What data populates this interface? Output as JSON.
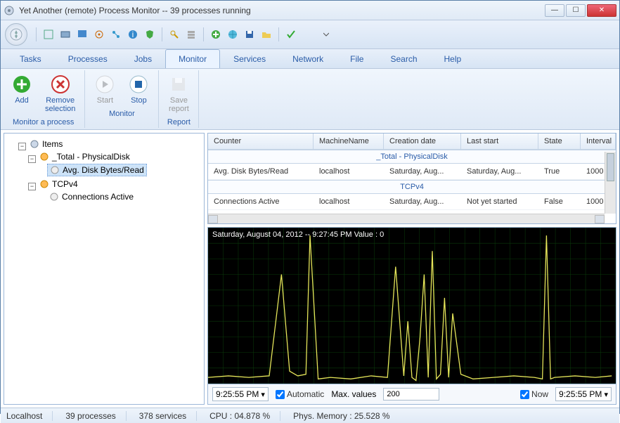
{
  "window": {
    "title": "Yet Another (remote) Process Monitor -- 39 processes running"
  },
  "menu": [
    "Tasks",
    "Processes",
    "Jobs",
    "Monitor",
    "Services",
    "Network",
    "File",
    "Search",
    "Help"
  ],
  "menu_active": 3,
  "ribbon": {
    "groups": [
      {
        "caption": "Monitor a process",
        "buttons": [
          {
            "label": "Add",
            "icon": "plus",
            "color": "#3a3"
          },
          {
            "label": "Remove\nselection",
            "icon": "x",
            "color": "#c33"
          }
        ]
      },
      {
        "caption": "Monitor",
        "buttons": [
          {
            "label": "Start",
            "icon": "play",
            "color": "#888",
            "disabled": true
          },
          {
            "label": "Stop",
            "icon": "stop",
            "color": "#26a"
          }
        ]
      },
      {
        "caption": "Report",
        "buttons": [
          {
            "label": "Save\nreport",
            "icon": "save",
            "color": "#aaa",
            "disabled": true
          }
        ]
      }
    ]
  },
  "tree": {
    "root": "Items",
    "nodes": [
      {
        "label": "_Total - PhysicalDisk",
        "icon": "disk",
        "children": [
          {
            "label": "Avg. Disk Bytes/Read",
            "icon": "counter",
            "selected": true
          }
        ]
      },
      {
        "label": "TCPv4",
        "icon": "net",
        "children": [
          {
            "label": "Connections Active",
            "icon": "counter"
          }
        ]
      }
    ]
  },
  "grid": {
    "columns": [
      "Counter",
      "MachineName",
      "Creation date",
      "Last start",
      "State",
      "Interval"
    ],
    "groups": [
      {
        "header": "_Total - PhysicalDisk",
        "rows": [
          [
            "Avg. Disk Bytes/Read",
            "localhost",
            "Saturday, Aug...",
            "Saturday, Aug...",
            "True",
            "1000"
          ]
        ]
      },
      {
        "header": "TCPv4",
        "rows": [
          [
            "Connections Active",
            "localhost",
            "Saturday, Aug...",
            "Not yet started",
            "False",
            "1000"
          ]
        ]
      }
    ]
  },
  "chart_info": "Saturday, August 04, 2012 -- 9:27:45 PM  Value : 0",
  "chart_data": {
    "type": "line",
    "title": "",
    "xlabel": "",
    "ylabel": "",
    "ylim": [
      0,
      100
    ],
    "x": [
      0,
      5,
      10,
      15,
      18,
      20,
      22,
      24,
      25,
      27,
      30,
      35,
      40,
      44,
      46,
      48,
      49,
      50,
      51,
      52,
      53,
      54,
      55,
      56,
      57,
      58,
      59,
      60,
      62,
      65,
      70,
      75,
      80,
      82,
      83,
      84,
      85,
      90,
      95,
      99
    ],
    "series": [
      {
        "name": "Avg. Disk Bytes/Read",
        "color": "#e6e65a",
        "values": [
          4,
          5,
          4,
          5,
          70,
          8,
          5,
          6,
          95,
          3,
          4,
          3,
          5,
          4,
          75,
          5,
          40,
          4,
          2,
          30,
          70,
          4,
          85,
          3,
          6,
          55,
          4,
          45,
          6,
          3,
          4,
          5,
          4,
          3,
          95,
          3,
          4,
          5,
          4,
          5
        ]
      }
    ]
  },
  "ctrl": {
    "time_from": "9:25:55 PM",
    "auto_label": "Automatic",
    "max_label": "Max. values",
    "max_value": "200",
    "now_label": "Now",
    "time_to": "9:25:55 PM"
  },
  "status": {
    "host": "Localhost",
    "procs": "39 processes",
    "svcs": "378 services",
    "cpu": "CPU : 04.878 %",
    "mem": "Phys. Memory : 25.528 %"
  }
}
